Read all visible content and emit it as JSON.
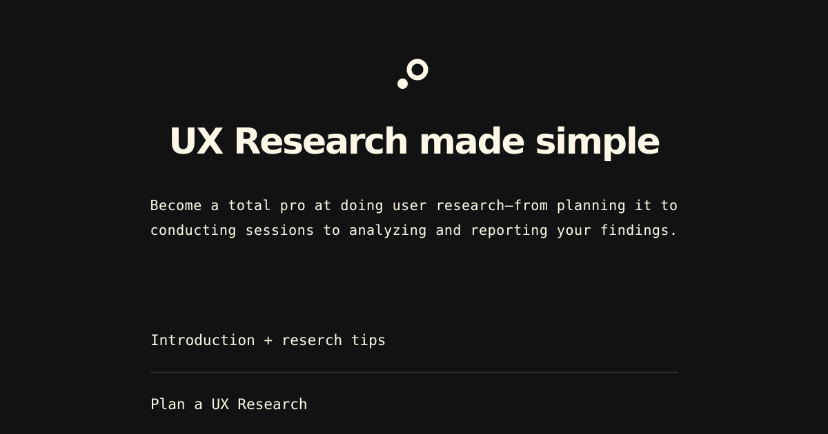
{
  "logo": {
    "icon": "dot-circle-logo-icon",
    "color": "#fbf8e8"
  },
  "title": "UX Research made simple",
  "description": "Become a total pro at doing user research—from planning it to conducting sessions to analyzing and reporting your findings.",
  "lessons": [
    {
      "label": "Introduction + reserch tips"
    },
    {
      "label": "Plan a UX Research"
    }
  ],
  "colors": {
    "background": "#121212",
    "text": "#fbf8e8",
    "divider": "#3a3a38"
  }
}
